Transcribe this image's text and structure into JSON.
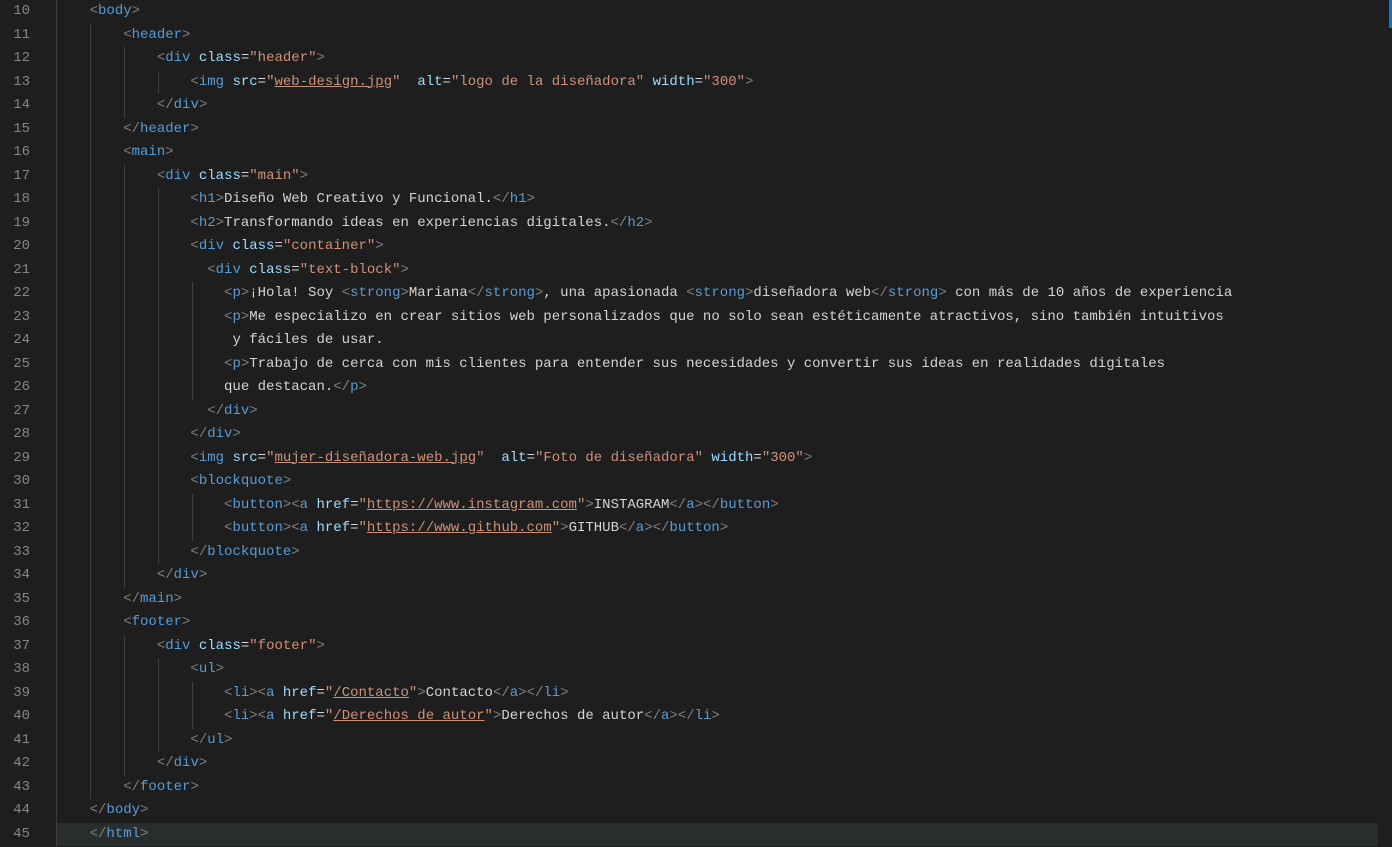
{
  "lineStart": 10,
  "lineEnd": 45,
  "lines": [
    {
      "indent": 1,
      "highlight": false,
      "tokens": [
        {
          "t": "br",
          "v": "<"
        },
        {
          "t": "tag",
          "v": "body"
        },
        {
          "t": "br",
          "v": ">"
        }
      ]
    },
    {
      "indent": 2,
      "highlight": false,
      "tokens": [
        {
          "t": "br",
          "v": "<"
        },
        {
          "t": "tag",
          "v": "header"
        },
        {
          "t": "br",
          "v": ">"
        }
      ]
    },
    {
      "indent": 3,
      "highlight": false,
      "tokens": [
        {
          "t": "br",
          "v": "<"
        },
        {
          "t": "tag",
          "v": "div"
        },
        {
          "t": "txt",
          "v": " "
        },
        {
          "t": "attr",
          "v": "class"
        },
        {
          "t": "txt",
          "v": "="
        },
        {
          "t": "str",
          "v": "\"header\""
        },
        {
          "t": "br",
          "v": ">"
        }
      ]
    },
    {
      "indent": 4,
      "highlight": false,
      "tokens": [
        {
          "t": "br",
          "v": "<"
        },
        {
          "t": "tag",
          "v": "img"
        },
        {
          "t": "txt",
          "v": " "
        },
        {
          "t": "attr",
          "v": "src"
        },
        {
          "t": "txt",
          "v": "="
        },
        {
          "t": "str",
          "v": "\""
        },
        {
          "t": "link",
          "v": "web-design.jpg"
        },
        {
          "t": "str",
          "v": "\""
        },
        {
          "t": "txt",
          "v": "  "
        },
        {
          "t": "attr",
          "v": "alt"
        },
        {
          "t": "txt",
          "v": "="
        },
        {
          "t": "str",
          "v": "\"logo de la diseñadora\""
        },
        {
          "t": "txt",
          "v": " "
        },
        {
          "t": "attr",
          "v": "width"
        },
        {
          "t": "txt",
          "v": "="
        },
        {
          "t": "str",
          "v": "\"300\""
        },
        {
          "t": "br",
          "v": ">"
        }
      ]
    },
    {
      "indent": 3,
      "highlight": false,
      "tokens": [
        {
          "t": "br",
          "v": "</"
        },
        {
          "t": "tag",
          "v": "div"
        },
        {
          "t": "br",
          "v": ">"
        }
      ]
    },
    {
      "indent": 2,
      "highlight": false,
      "tokens": [
        {
          "t": "br",
          "v": "</"
        },
        {
          "t": "tag",
          "v": "header"
        },
        {
          "t": "br",
          "v": ">"
        }
      ]
    },
    {
      "indent": 2,
      "highlight": false,
      "tokens": [
        {
          "t": "br",
          "v": "<"
        },
        {
          "t": "tag",
          "v": "main"
        },
        {
          "t": "br",
          "v": ">"
        }
      ]
    },
    {
      "indent": 3,
      "highlight": false,
      "tokens": [
        {
          "t": "br",
          "v": "<"
        },
        {
          "t": "tag",
          "v": "div"
        },
        {
          "t": "txt",
          "v": " "
        },
        {
          "t": "attr",
          "v": "class"
        },
        {
          "t": "txt",
          "v": "="
        },
        {
          "t": "str",
          "v": "\"main\""
        },
        {
          "t": "br",
          "v": ">"
        }
      ]
    },
    {
      "indent": 4,
      "highlight": false,
      "tokens": [
        {
          "t": "br",
          "v": "<"
        },
        {
          "t": "tag",
          "v": "h1"
        },
        {
          "t": "br",
          "v": ">"
        },
        {
          "t": "txt",
          "v": "Diseño Web Creativo y Funcional."
        },
        {
          "t": "br",
          "v": "</"
        },
        {
          "t": "tag",
          "v": "h1"
        },
        {
          "t": "br",
          "v": ">"
        }
      ]
    },
    {
      "indent": 4,
      "highlight": false,
      "tokens": [
        {
          "t": "br",
          "v": "<"
        },
        {
          "t": "tag",
          "v": "h2"
        },
        {
          "t": "br",
          "v": ">"
        },
        {
          "t": "txt",
          "v": "Transformando ideas en experiencias digitales."
        },
        {
          "t": "br",
          "v": "</"
        },
        {
          "t": "tag",
          "v": "h2"
        },
        {
          "t": "br",
          "v": ">"
        }
      ]
    },
    {
      "indent": 4,
      "highlight": false,
      "tokens": [
        {
          "t": "br",
          "v": "<"
        },
        {
          "t": "tag",
          "v": "div"
        },
        {
          "t": "txt",
          "v": " "
        },
        {
          "t": "attr",
          "v": "class"
        },
        {
          "t": "txt",
          "v": "="
        },
        {
          "t": "str",
          "v": "\"container\""
        },
        {
          "t": "br",
          "v": ">"
        }
      ]
    },
    {
      "indent": 4,
      "extraPad": 2,
      "highlight": false,
      "tokens": [
        {
          "t": "br",
          "v": "<"
        },
        {
          "t": "tag",
          "v": "div"
        },
        {
          "t": "txt",
          "v": " "
        },
        {
          "t": "attr",
          "v": "class"
        },
        {
          "t": "txt",
          "v": "="
        },
        {
          "t": "str",
          "v": "\"text-block\""
        },
        {
          "t": "br",
          "v": ">"
        }
      ]
    },
    {
      "indent": 5,
      "highlight": false,
      "tokens": [
        {
          "t": "br",
          "v": "<"
        },
        {
          "t": "tag",
          "v": "p"
        },
        {
          "t": "br",
          "v": ">"
        },
        {
          "t": "txt",
          "v": "¡Hola! Soy "
        },
        {
          "t": "br",
          "v": "<"
        },
        {
          "t": "tag",
          "v": "strong"
        },
        {
          "t": "br",
          "v": ">"
        },
        {
          "t": "txt",
          "v": "Mariana"
        },
        {
          "t": "br",
          "v": "</"
        },
        {
          "t": "tag",
          "v": "strong"
        },
        {
          "t": "br",
          "v": ">"
        },
        {
          "t": "txt",
          "v": ", una apasionada "
        },
        {
          "t": "br",
          "v": "<"
        },
        {
          "t": "tag",
          "v": "strong"
        },
        {
          "t": "br",
          "v": ">"
        },
        {
          "t": "txt",
          "v": "diseñadora web"
        },
        {
          "t": "br",
          "v": "</"
        },
        {
          "t": "tag",
          "v": "strong"
        },
        {
          "t": "br",
          "v": ">"
        },
        {
          "t": "txt",
          "v": " con más de 10 años de experiencia"
        }
      ]
    },
    {
      "indent": 5,
      "highlight": false,
      "tokens": [
        {
          "t": "br",
          "v": "<"
        },
        {
          "t": "tag",
          "v": "p"
        },
        {
          "t": "br",
          "v": ">"
        },
        {
          "t": "txt",
          "v": "Me especializo en crear sitios web personalizados que no solo sean estéticamente atractivos, sino también intuitivos"
        }
      ]
    },
    {
      "indent": 5,
      "extraPad": 1,
      "highlight": false,
      "tokens": [
        {
          "t": "txt",
          "v": "y fáciles de usar."
        }
      ]
    },
    {
      "indent": 5,
      "highlight": false,
      "tokens": [
        {
          "t": "br",
          "v": "<"
        },
        {
          "t": "tag",
          "v": "p"
        },
        {
          "t": "br",
          "v": ">"
        },
        {
          "t": "txt",
          "v": "Trabajo de cerca con mis clientes para entender sus necesidades y convertir sus ideas en realidades digitales "
        }
      ]
    },
    {
      "indent": 5,
      "highlight": false,
      "tokens": [
        {
          "t": "txt",
          "v": "que destacan."
        },
        {
          "t": "br",
          "v": "</"
        },
        {
          "t": "tag",
          "v": "p"
        },
        {
          "t": "br",
          "v": ">"
        }
      ]
    },
    {
      "indent": 4,
      "extraPad": 2,
      "highlight": false,
      "tokens": [
        {
          "t": "br",
          "v": "</"
        },
        {
          "t": "tag",
          "v": "div"
        },
        {
          "t": "br",
          "v": ">"
        }
      ]
    },
    {
      "indent": 4,
      "highlight": false,
      "tokens": [
        {
          "t": "br",
          "v": "</"
        },
        {
          "t": "tag",
          "v": "div"
        },
        {
          "t": "br",
          "v": ">"
        }
      ]
    },
    {
      "indent": 4,
      "highlight": false,
      "tokens": [
        {
          "t": "br",
          "v": "<"
        },
        {
          "t": "tag",
          "v": "img"
        },
        {
          "t": "txt",
          "v": " "
        },
        {
          "t": "attr",
          "v": "src"
        },
        {
          "t": "txt",
          "v": "="
        },
        {
          "t": "str",
          "v": "\""
        },
        {
          "t": "link",
          "v": "mujer-diseñadora-web.jpg"
        },
        {
          "t": "str",
          "v": "\""
        },
        {
          "t": "txt",
          "v": "  "
        },
        {
          "t": "attr",
          "v": "alt"
        },
        {
          "t": "txt",
          "v": "="
        },
        {
          "t": "str",
          "v": "\"Foto de diseñadora\""
        },
        {
          "t": "txt",
          "v": " "
        },
        {
          "t": "attr",
          "v": "width"
        },
        {
          "t": "txt",
          "v": "="
        },
        {
          "t": "str",
          "v": "\"300\""
        },
        {
          "t": "br",
          "v": ">"
        }
      ]
    },
    {
      "indent": 4,
      "highlight": false,
      "tokens": [
        {
          "t": "br",
          "v": "<"
        },
        {
          "t": "tag",
          "v": "blockquote"
        },
        {
          "t": "br",
          "v": ">"
        }
      ]
    },
    {
      "indent": 5,
      "highlight": false,
      "tokens": [
        {
          "t": "br",
          "v": "<"
        },
        {
          "t": "tag",
          "v": "button"
        },
        {
          "t": "br",
          "v": ">"
        },
        {
          "t": "br",
          "v": "<"
        },
        {
          "t": "tag",
          "v": "a"
        },
        {
          "t": "txt",
          "v": " "
        },
        {
          "t": "attr",
          "v": "href"
        },
        {
          "t": "txt",
          "v": "="
        },
        {
          "t": "str",
          "v": "\""
        },
        {
          "t": "link",
          "v": "https://www.instagram.com"
        },
        {
          "t": "str",
          "v": "\""
        },
        {
          "t": "br",
          "v": ">"
        },
        {
          "t": "txt",
          "v": "INSTAGRAM"
        },
        {
          "t": "br",
          "v": "</"
        },
        {
          "t": "tag",
          "v": "a"
        },
        {
          "t": "br",
          "v": ">"
        },
        {
          "t": "br",
          "v": "</"
        },
        {
          "t": "tag",
          "v": "button"
        },
        {
          "t": "br",
          "v": ">"
        }
      ]
    },
    {
      "indent": 5,
      "highlight": false,
      "tokens": [
        {
          "t": "br",
          "v": "<"
        },
        {
          "t": "tag",
          "v": "button"
        },
        {
          "t": "br",
          "v": ">"
        },
        {
          "t": "br",
          "v": "<"
        },
        {
          "t": "tag",
          "v": "a"
        },
        {
          "t": "txt",
          "v": " "
        },
        {
          "t": "attr",
          "v": "href"
        },
        {
          "t": "txt",
          "v": "="
        },
        {
          "t": "str",
          "v": "\""
        },
        {
          "t": "link",
          "v": "https://www.github.com"
        },
        {
          "t": "str",
          "v": "\""
        },
        {
          "t": "br",
          "v": ">"
        },
        {
          "t": "txt",
          "v": "GITHUB"
        },
        {
          "t": "br",
          "v": "</"
        },
        {
          "t": "tag",
          "v": "a"
        },
        {
          "t": "br",
          "v": ">"
        },
        {
          "t": "br",
          "v": "</"
        },
        {
          "t": "tag",
          "v": "button"
        },
        {
          "t": "br",
          "v": ">"
        }
      ]
    },
    {
      "indent": 4,
      "highlight": false,
      "tokens": [
        {
          "t": "br",
          "v": "</"
        },
        {
          "t": "tag",
          "v": "blockquote"
        },
        {
          "t": "br",
          "v": ">"
        }
      ]
    },
    {
      "indent": 3,
      "highlight": false,
      "tokens": [
        {
          "t": "br",
          "v": "</"
        },
        {
          "t": "tag",
          "v": "div"
        },
        {
          "t": "br",
          "v": ">"
        }
      ]
    },
    {
      "indent": 2,
      "highlight": false,
      "tokens": [
        {
          "t": "br",
          "v": "</"
        },
        {
          "t": "tag",
          "v": "main"
        },
        {
          "t": "br",
          "v": ">"
        }
      ]
    },
    {
      "indent": 2,
      "highlight": false,
      "tokens": [
        {
          "t": "br",
          "v": "<"
        },
        {
          "t": "tag",
          "v": "footer"
        },
        {
          "t": "br",
          "v": ">"
        }
      ]
    },
    {
      "indent": 3,
      "highlight": false,
      "tokens": [
        {
          "t": "br",
          "v": "<"
        },
        {
          "t": "tag",
          "v": "div"
        },
        {
          "t": "txt",
          "v": " "
        },
        {
          "t": "attr",
          "v": "class"
        },
        {
          "t": "txt",
          "v": "="
        },
        {
          "t": "str",
          "v": "\"footer\""
        },
        {
          "t": "br",
          "v": ">"
        }
      ]
    },
    {
      "indent": 4,
      "highlight": false,
      "tokens": [
        {
          "t": "br",
          "v": "<"
        },
        {
          "t": "tag",
          "v": "ul"
        },
        {
          "t": "br",
          "v": ">"
        }
      ]
    },
    {
      "indent": 5,
      "highlight": false,
      "tokens": [
        {
          "t": "br",
          "v": "<"
        },
        {
          "t": "tag",
          "v": "li"
        },
        {
          "t": "br",
          "v": ">"
        },
        {
          "t": "br",
          "v": "<"
        },
        {
          "t": "tag",
          "v": "a"
        },
        {
          "t": "txt",
          "v": " "
        },
        {
          "t": "attr",
          "v": "href"
        },
        {
          "t": "txt",
          "v": "="
        },
        {
          "t": "str",
          "v": "\""
        },
        {
          "t": "link",
          "v": "/Contacto"
        },
        {
          "t": "str",
          "v": "\""
        },
        {
          "t": "br",
          "v": ">"
        },
        {
          "t": "txt",
          "v": "Contacto"
        },
        {
          "t": "br",
          "v": "</"
        },
        {
          "t": "tag",
          "v": "a"
        },
        {
          "t": "br",
          "v": ">"
        },
        {
          "t": "br",
          "v": "</"
        },
        {
          "t": "tag",
          "v": "li"
        },
        {
          "t": "br",
          "v": ">"
        }
      ]
    },
    {
      "indent": 5,
      "highlight": false,
      "tokens": [
        {
          "t": "br",
          "v": "<"
        },
        {
          "t": "tag",
          "v": "li"
        },
        {
          "t": "br",
          "v": ">"
        },
        {
          "t": "br",
          "v": "<"
        },
        {
          "t": "tag",
          "v": "a"
        },
        {
          "t": "txt",
          "v": " "
        },
        {
          "t": "attr",
          "v": "href"
        },
        {
          "t": "txt",
          "v": "="
        },
        {
          "t": "str",
          "v": "\""
        },
        {
          "t": "link",
          "v": "/Derechos de autor"
        },
        {
          "t": "str",
          "v": "\""
        },
        {
          "t": "br",
          "v": ">"
        },
        {
          "t": "txt",
          "v": "Derechos de autor"
        },
        {
          "t": "br",
          "v": "</"
        },
        {
          "t": "tag",
          "v": "a"
        },
        {
          "t": "br",
          "v": ">"
        },
        {
          "t": "br",
          "v": "</"
        },
        {
          "t": "tag",
          "v": "li"
        },
        {
          "t": "br",
          "v": ">"
        }
      ]
    },
    {
      "indent": 4,
      "highlight": false,
      "tokens": [
        {
          "t": "br",
          "v": "</"
        },
        {
          "t": "tag",
          "v": "ul"
        },
        {
          "t": "br",
          "v": ">"
        }
      ]
    },
    {
      "indent": 3,
      "highlight": false,
      "tokens": [
        {
          "t": "br",
          "v": "</"
        },
        {
          "t": "tag",
          "v": "div"
        },
        {
          "t": "br",
          "v": ">"
        }
      ]
    },
    {
      "indent": 2,
      "highlight": false,
      "tokens": [
        {
          "t": "br",
          "v": "</"
        },
        {
          "t": "tag",
          "v": "footer"
        },
        {
          "t": "br",
          "v": ">"
        }
      ]
    },
    {
      "indent": 1,
      "highlight": false,
      "tokens": [
        {
          "t": "br",
          "v": "</"
        },
        {
          "t": "tag",
          "v": "body"
        },
        {
          "t": "br",
          "v": ">"
        }
      ]
    },
    {
      "indent": 1,
      "highlight": true,
      "tokens": [
        {
          "t": "br",
          "v": "</"
        },
        {
          "t": "tag",
          "v": "html"
        },
        {
          "t": "br",
          "v": ">"
        }
      ]
    }
  ]
}
